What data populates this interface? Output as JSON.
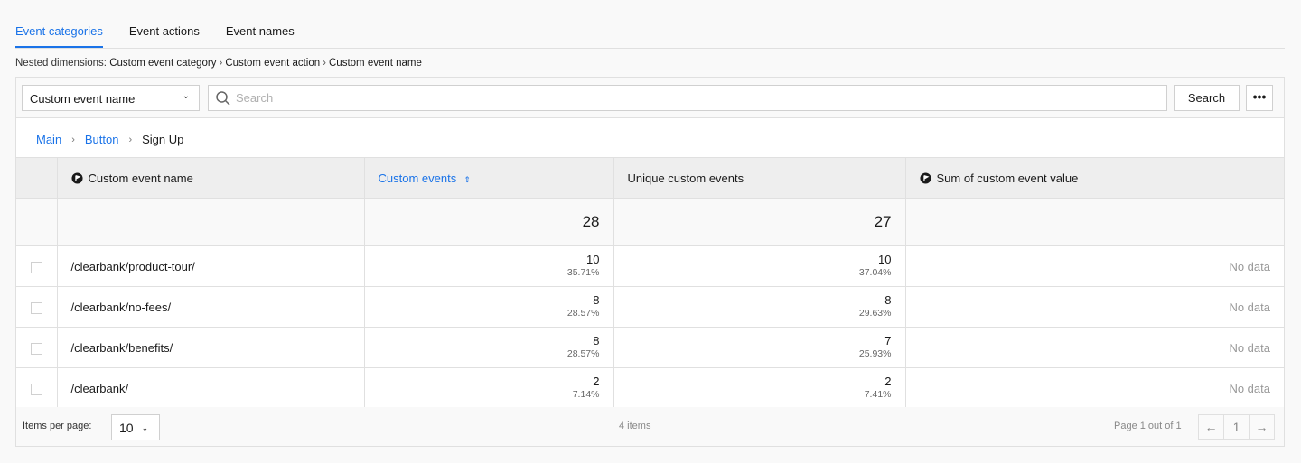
{
  "tabs": [
    {
      "label": "Event categories",
      "active": true
    },
    {
      "label": "Event actions",
      "active": false
    },
    {
      "label": "Event names",
      "active": false
    }
  ],
  "nested_dimensions": {
    "label": "Nested dimensions:",
    "levels": [
      "Custom event category",
      "Custom event action",
      "Custom event name"
    ],
    "separator": "›"
  },
  "toolbar": {
    "dimension_select": "Custom event name",
    "search_placeholder": "Search",
    "search_value": "",
    "search_button": "Search",
    "more_button": "•••"
  },
  "breadcrumb": {
    "items": [
      "Main",
      "Button"
    ],
    "current": "Sign Up",
    "separator": "›"
  },
  "table": {
    "columns": [
      {
        "label": "Custom event name",
        "icon": "segment-icon"
      },
      {
        "label": "Custom events",
        "sorted": true,
        "sort_icon": "⇕"
      },
      {
        "label": "Unique custom events"
      },
      {
        "label": "Sum of custom event value",
        "icon": "segment-icon"
      }
    ],
    "totals": {
      "custom_events": "28",
      "unique_custom_events": "27",
      "sum_value": ""
    },
    "rows": [
      {
        "name": "/clearbank/product-tour/",
        "events": "10",
        "events_pct": "35.71%",
        "unique": "10",
        "unique_pct": "37.04%",
        "sum": "No data"
      },
      {
        "name": "/clearbank/no-fees/",
        "events": "8",
        "events_pct": "28.57%",
        "unique": "8",
        "unique_pct": "29.63%",
        "sum": "No data"
      },
      {
        "name": "/clearbank/benefits/",
        "events": "8",
        "events_pct": "28.57%",
        "unique": "7",
        "unique_pct": "25.93%",
        "sum": "No data"
      },
      {
        "name": "/clearbank/",
        "events": "2",
        "events_pct": "7.14%",
        "unique": "2",
        "unique_pct": "7.41%",
        "sum": "No data"
      }
    ]
  },
  "footer": {
    "items_per_page_label": "Items per page:",
    "items_per_page": "10",
    "item_count": "4 items",
    "page_info": "Page 1 out of 1",
    "current_page": "1",
    "prev_icon": "←",
    "next_icon": "→"
  },
  "colors": {
    "accent": "#1a73e8",
    "header_bg": "#eeeeee",
    "border": "#e0e0e0"
  }
}
